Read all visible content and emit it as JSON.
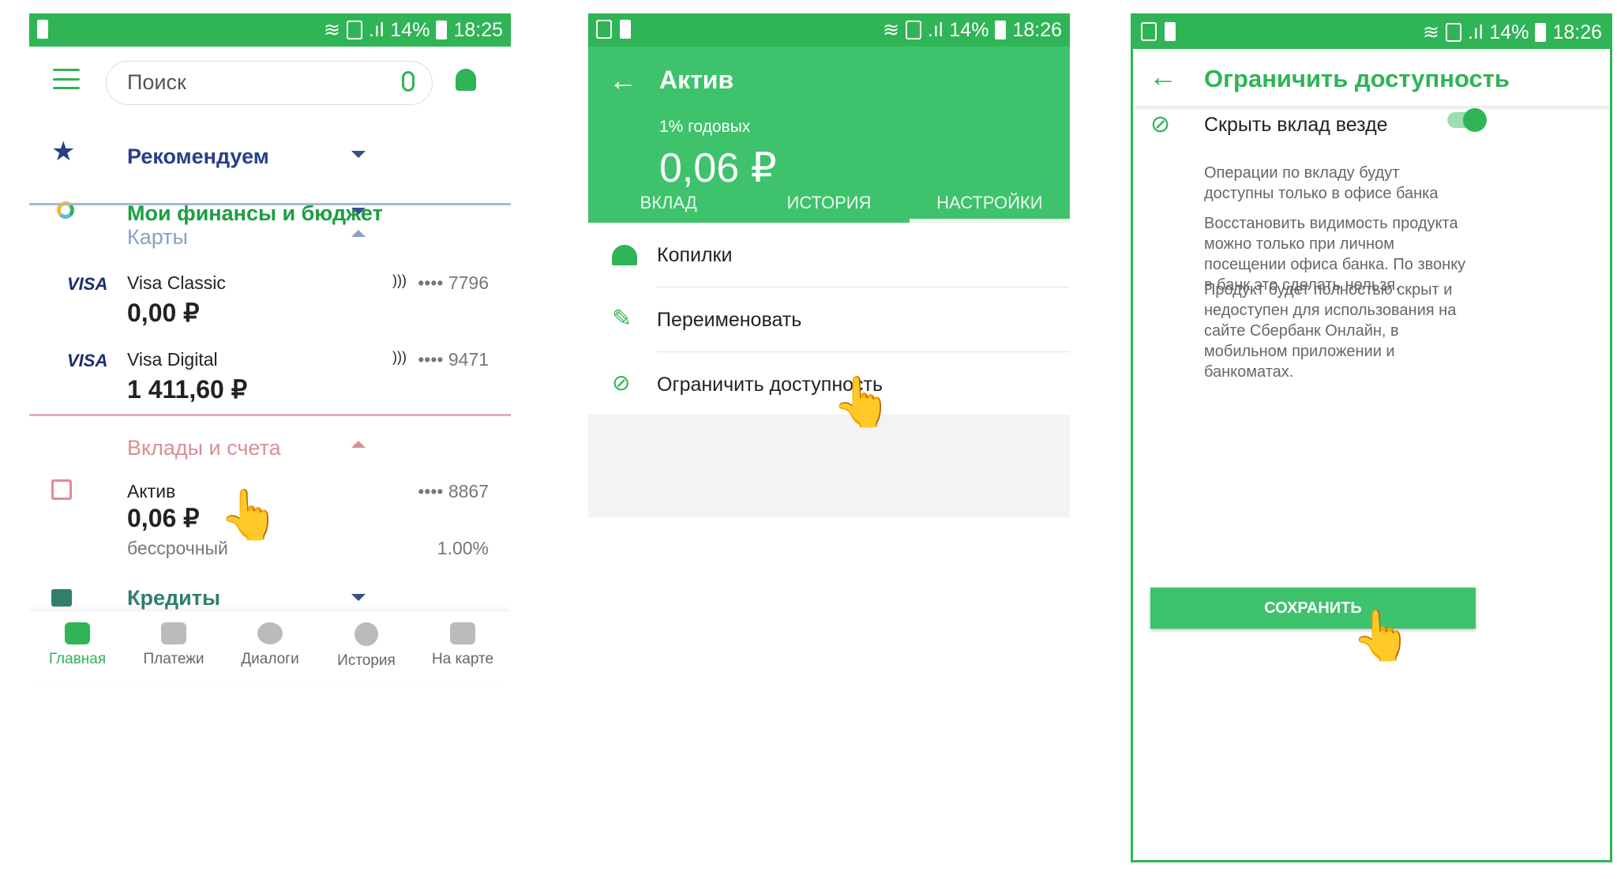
{
  "colors": {
    "brand": "#2fb456",
    "accent_light": "#3ec26c",
    "blue": "#283e8c",
    "cards_section": "#8aa0c8",
    "deposits_section": "#d98f96"
  },
  "phone1": {
    "status": {
      "battery": "14%",
      "time": "18:25"
    },
    "search": {
      "placeholder": "Поиск"
    },
    "sections": [
      {
        "label": "Рекомендуем",
        "icon": "star-icon"
      },
      {
        "label": "Мои финансы и бюджет",
        "icon": "donut-chart-icon"
      }
    ],
    "cards": {
      "header": "Карты",
      "items": [
        {
          "brand": "VISA",
          "name": "Visa Classic",
          "number": "•••• 7796",
          "balance": "0,00 ₽"
        },
        {
          "brand": "VISA",
          "name": "Visa Digital",
          "number": "•••• 9471",
          "balance": "1 411,60 ₽"
        }
      ]
    },
    "deposits": {
      "header": "Вклады и счета",
      "items": [
        {
          "name": "Актив",
          "number": "•••• 8867",
          "balance": "0,06 ₽",
          "term": "бессрочный",
          "rate": "1.00%"
        }
      ]
    },
    "credits": {
      "header": "Кредиты"
    },
    "nav": [
      {
        "label": "Главная",
        "icon": "home-icon",
        "active": true
      },
      {
        "label": "Платежи",
        "icon": "transfer-icon"
      },
      {
        "label": "Диалоги",
        "icon": "chat-icon"
      },
      {
        "label": "История",
        "icon": "clock-icon"
      },
      {
        "label": "На карте",
        "icon": "map-icon"
      }
    ]
  },
  "phone2": {
    "status": {
      "battery": "14%",
      "time": "18:26"
    },
    "title": "Актив",
    "rate": "1% годовых",
    "balance": "0,06 ₽",
    "tabs": [
      {
        "label": "ВКЛАД"
      },
      {
        "label": "ИСТОРИЯ"
      },
      {
        "label": "НАСТРОЙКИ",
        "active": true
      }
    ],
    "menu": [
      {
        "label": "Копилки",
        "icon": "piggy-bank-icon"
      },
      {
        "label": "Переименовать",
        "icon": "pencil-icon"
      },
      {
        "label": "Ограничить доступность",
        "icon": "eye-off-icon"
      }
    ]
  },
  "phone3": {
    "status": {
      "battery": "14%",
      "time": "18:26"
    },
    "title": "Ограничить доступность",
    "toggle_label": "Скрыть вклад везде",
    "toggle_on": true,
    "note1": "Операции по вкладу будут доступны только в офисе банка",
    "note2": "Восстановить видимость продукта можно только при личном посещении офиса банка. По звонку в банк это сделать нельзя.",
    "note3": "Продукт будет полностью скрыт и недоступен для использования на сайте Сбербанк Онлайн, в мобильном приложении и банкоматах.",
    "save_button": "СОХРАНИТЬ"
  }
}
